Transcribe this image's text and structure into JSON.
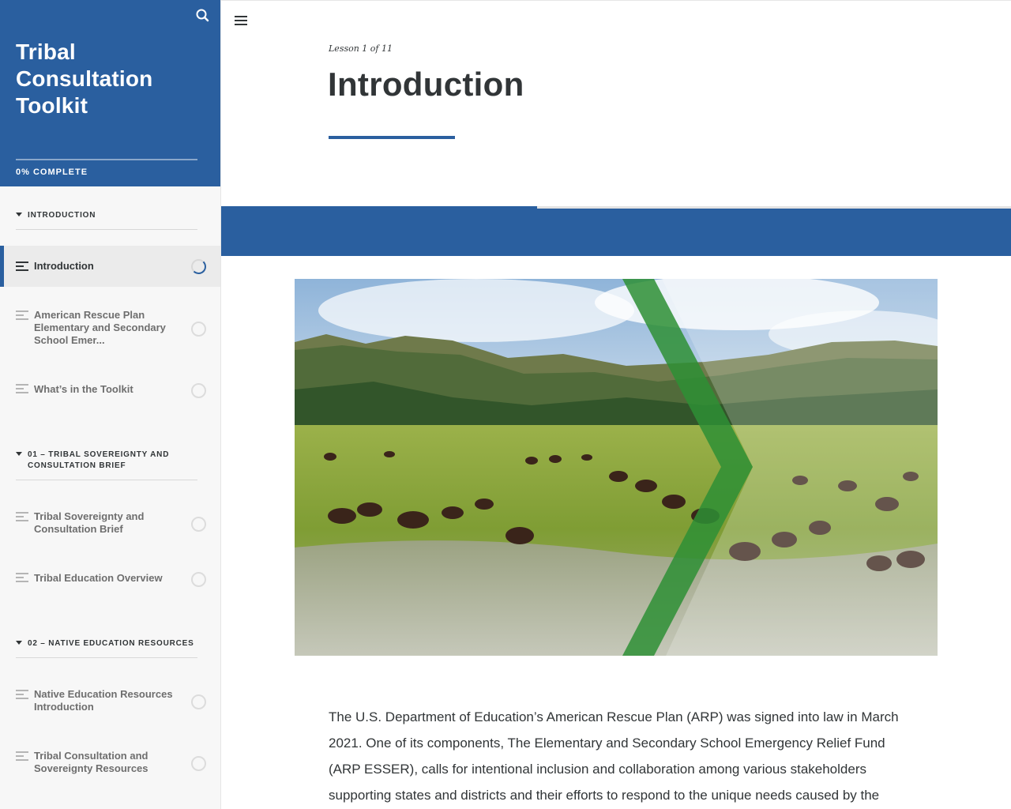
{
  "sidebar": {
    "title": "Tribal Consultation Toolkit",
    "progress": {
      "percent": 0,
      "label": "0% COMPLETE"
    },
    "icons": {
      "search": "search-icon",
      "lesson": "lesson-text-icon",
      "status": "status-circle-icon",
      "caret": "caret-down-icon"
    },
    "sections": [
      {
        "title": "INTRODUCTION",
        "lessons": [
          {
            "label": "Introduction",
            "status": "in-progress",
            "active": true
          },
          {
            "label": "American Rescue Plan Elementary and Secondary School Emer...",
            "status": "not-started"
          },
          {
            "label": "What’s in the Toolkit",
            "status": "not-started"
          }
        ]
      },
      {
        "title": "01 – TRIBAL SOVEREIGNTY AND CONSULTATION BRIEF",
        "lessons": [
          {
            "label": "Tribal Sovereignty and Consultation Brief",
            "status": "not-started"
          },
          {
            "label": "Tribal Education Overview",
            "status": "not-started"
          }
        ]
      },
      {
        "title": "02 – NATIVE EDUCATION RESOURCES",
        "lessons": [
          {
            "label": "Native Education Resources Introduction",
            "status": "not-started"
          },
          {
            "label": "Tribal Consultation and Sovereignty Resources",
            "status": "not-started"
          }
        ]
      }
    ]
  },
  "main": {
    "menu_icon": "hamburger-menu-icon",
    "lesson_count": "Lesson 1 of 11",
    "title": "Introduction",
    "accent_color": "#2a5f9f",
    "lesson_progress_fraction": 0.4,
    "hero_image": "bison herd grazing in a green valley with hills and a green chevron overlay",
    "body": "The U.S. Department of Education’s American Rescue Plan (ARP) was signed into law in March 2021. One of its components, The Elementary and Secondary School Emergency Relief Fund (ARP ESSER), calls for intentional inclusion and collaboration among various stakeholders supporting states and districts and their efforts to respond to the unique needs caused by the global pandemic."
  }
}
